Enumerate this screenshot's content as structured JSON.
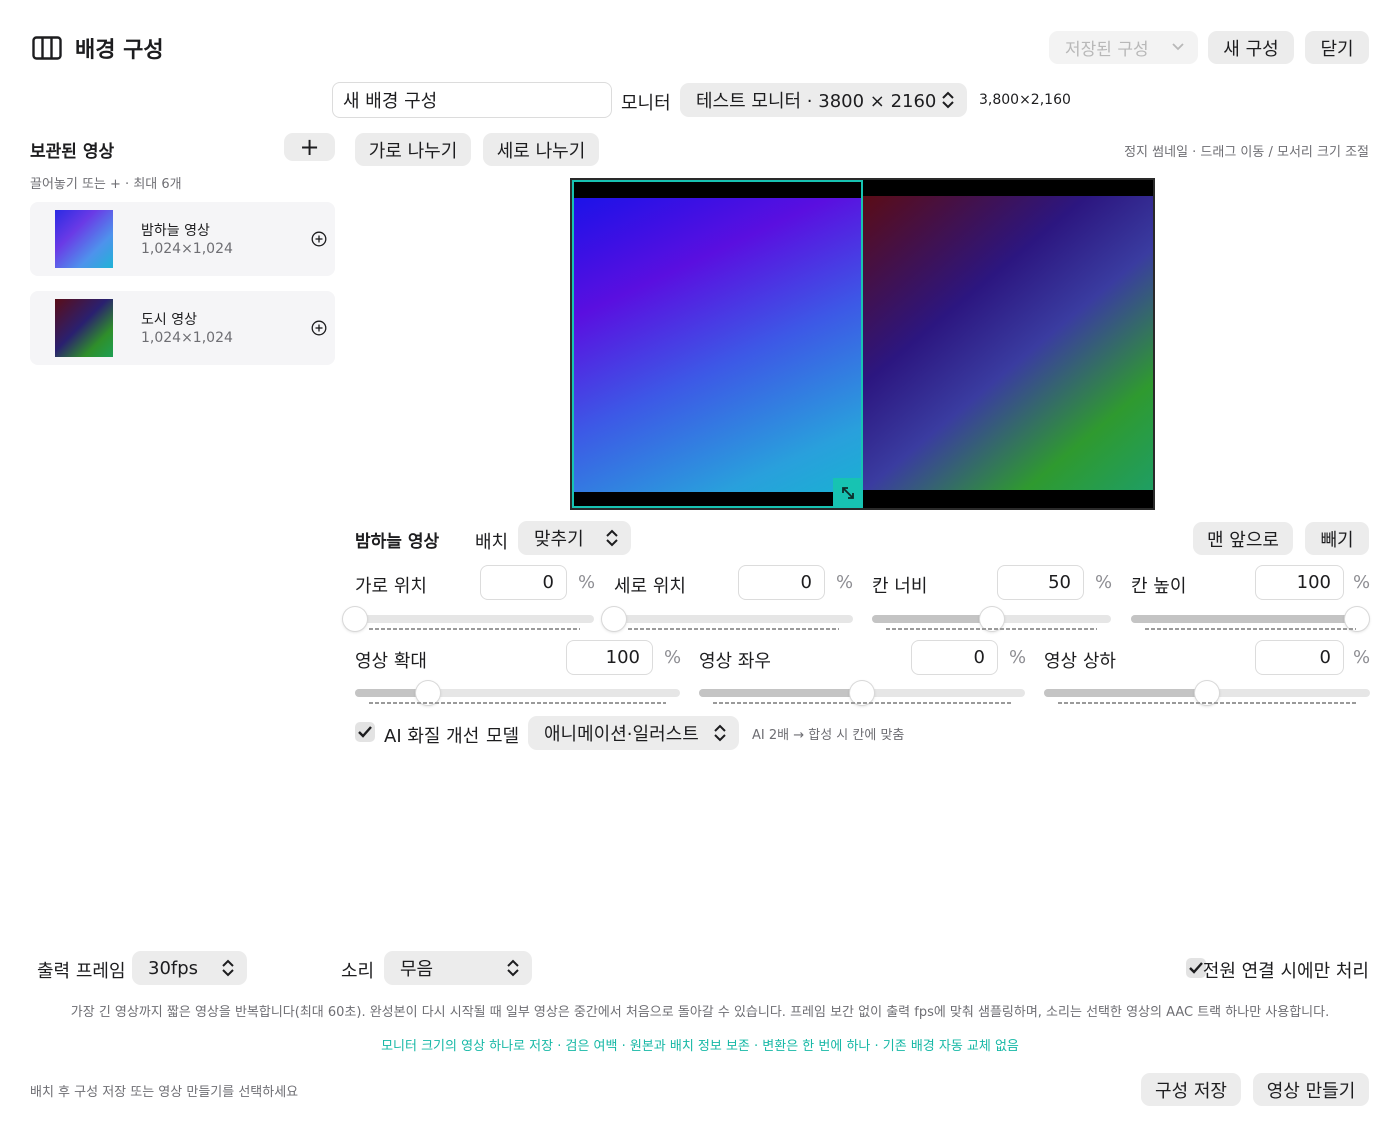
{
  "header": {
    "title": "배경 구성",
    "saved_configs_placeholder": "저장된 구성",
    "new_config_label": "새 구성",
    "close_label": "닫기"
  },
  "config_bar": {
    "name_value": "새 배경 구성",
    "monitor_label": "모니터",
    "monitor_value": "테스트 모니터 · 3800 × 2160",
    "resolution_text": "3,800×2,160"
  },
  "library": {
    "title": "보관된 영상",
    "add_label": "+",
    "hint": "끌어놓기 또는 + · 최대 6개",
    "items": [
      {
        "name": "밤하늘 영상",
        "size": "1,024×1,024"
      },
      {
        "name": "도시 영상",
        "size": "1,024×1,024"
      }
    ]
  },
  "layout_tools": {
    "split_horizontal": "가로 나누기",
    "split_vertical": "세로 나누기",
    "hint": "정지 썸네일 · 드래그 이동 / 모서리 크기 조절"
  },
  "preview": {
    "accent_color": "#17c3b2"
  },
  "cell": {
    "title": "밤하늘 영상",
    "placement_label": "배치",
    "placement_value": "맞추기",
    "bring_front_label": "맨 앞으로",
    "remove_label": "빼기",
    "percent": "%",
    "params": {
      "x": {
        "label": "가로 위치",
        "value": "0",
        "level": 0
      },
      "y": {
        "label": "세로 위치",
        "value": "0",
        "level": 0
      },
      "w": {
        "label": "칸 너비",
        "value": "50",
        "level": 0.5
      },
      "h": {
        "label": "칸 높이",
        "value": "100",
        "level": 1
      },
      "zoom": {
        "label": "영상 확대",
        "value": "100",
        "level": 0.225
      },
      "panx": {
        "label": "영상 좌우",
        "value": "0",
        "level": 0.5
      },
      "pany": {
        "label": "영상 상하",
        "value": "0",
        "level": 0.5
      }
    },
    "ai": {
      "label": "AI 화질 개선",
      "checked": true,
      "model_label": "모델",
      "model_value": "애니메이션·일러스트",
      "hint": "AI 2배 → 합성 시 칸에 맞춤"
    }
  },
  "output": {
    "fps_label": "출력 프레임",
    "fps_value": "30fps",
    "sound_label": "소리",
    "sound_value": "무음",
    "power_label": "전원 연결 시에만 처리",
    "power_checked": true,
    "note": "가장 긴 영상까지 짧은 영상을 반복합니다(최대 60초). 완성본이 다시 시작될 때 일부 영상은 중간에서 처음으로 돌아갈 수 있습니다. 프레임 보간 없이 출력 fps에 맞춰 샘플링하며, 소리는 선택한 영상의 AAC 트랙 하나만 사용합니다.",
    "highlight": "모니터 크기의 영상 하나로 저장 · 검은 여백 · 원본과 배치 정보 보존 · 변환은 한 번에 하나 · 기존 배경 자동 교체 없음",
    "highlight_color": "#17b8a6"
  },
  "footer": {
    "status": "배치 후 구성 저장 또는 영상 만들기를 선택하세요",
    "save_label": "구성 저장",
    "make_label": "영상 만들기"
  }
}
